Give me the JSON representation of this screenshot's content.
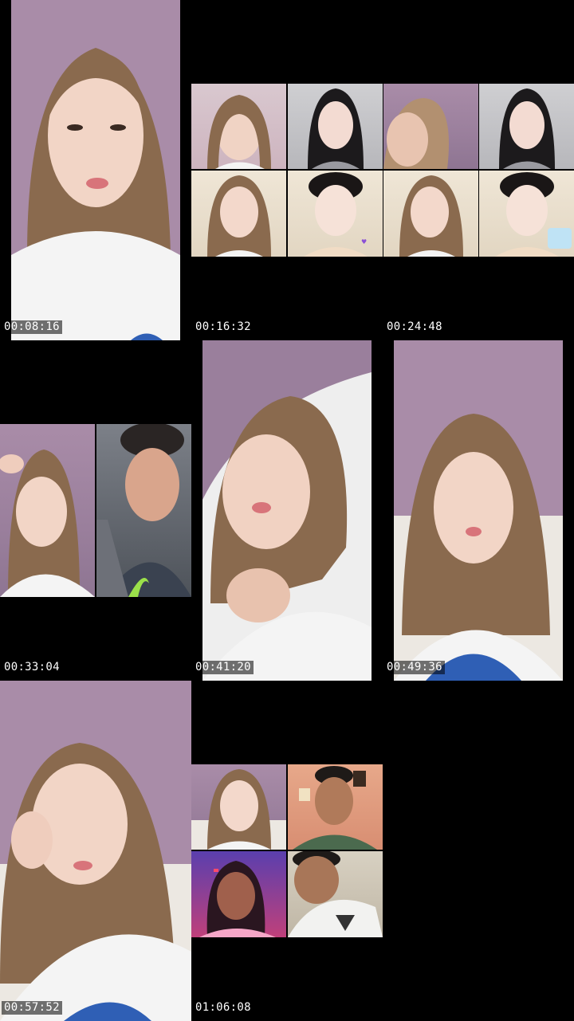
{
  "grid": {
    "cells": [
      {
        "timestamp": "00:08:16",
        "layout": "single-left"
      },
      {
        "timestamp": "00:16:32",
        "layout": "empty"
      },
      {
        "timestamp": "00:24:48",
        "layout": "empty"
      },
      {
        "timestamp": "00:33:04",
        "layout": "split-two"
      },
      {
        "timestamp": "00:41:20",
        "layout": "single"
      },
      {
        "timestamp": "00:49:36",
        "layout": "single"
      },
      {
        "timestamp": "00:57:52",
        "layout": "single-full"
      },
      {
        "timestamp": "01:06:08",
        "layout": "quad"
      },
      {
        "timestamp": "",
        "layout": "empty"
      }
    ],
    "wide_grid_top": {
      "rows": 2,
      "cols": 4
    }
  },
  "colors": {
    "background": "#000000",
    "timestamp_text": "#ffffff",
    "wall_purple": "#a98ca8",
    "shirt_white": "#f4f4f4",
    "hair_brown": "#8a6a4e"
  }
}
